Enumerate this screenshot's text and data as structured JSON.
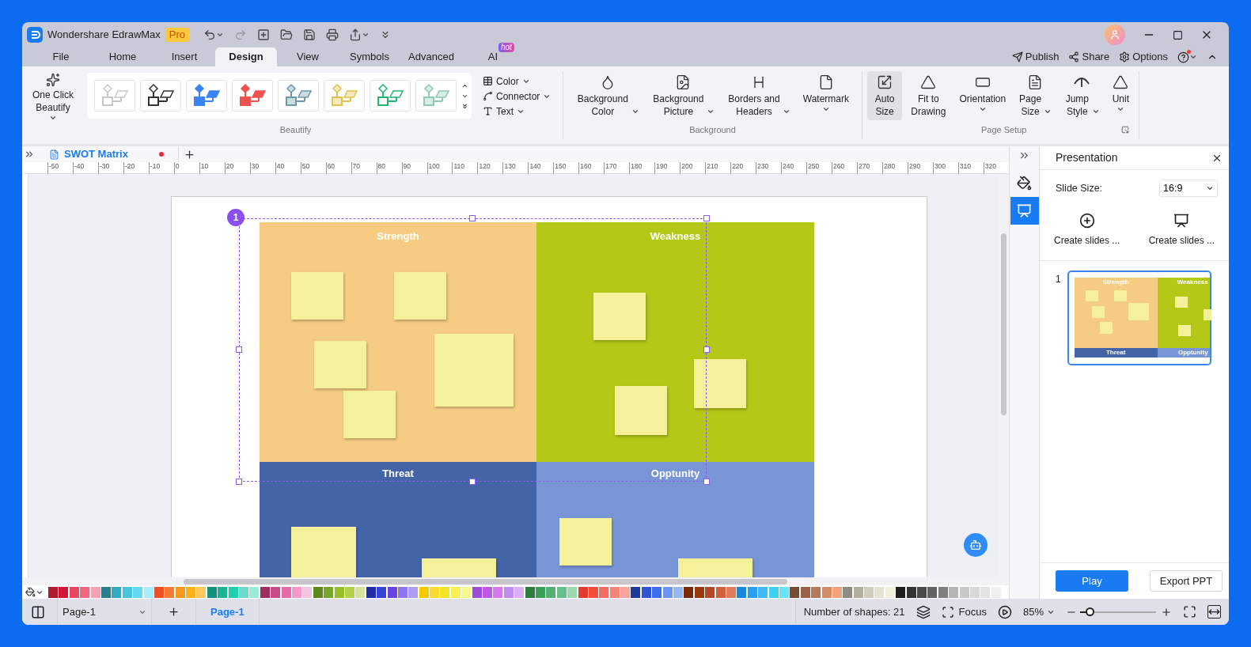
{
  "app": {
    "name": "Wondershare EdrawMax",
    "badge": "Pro"
  },
  "menu_tabs": [
    {
      "label": "File",
      "selected": false
    },
    {
      "label": "Home",
      "selected": false
    },
    {
      "label": "Insert",
      "selected": false
    },
    {
      "label": "Design",
      "selected": true
    },
    {
      "label": "View",
      "selected": false
    },
    {
      "label": "Symbols",
      "selected": false
    },
    {
      "label": "Advanced",
      "selected": false
    },
    {
      "label": "AI",
      "selected": false,
      "badge": "hot"
    }
  ],
  "header_actions": [
    {
      "label": "Publish"
    },
    {
      "label": "Share"
    },
    {
      "label": "Options"
    }
  ],
  "help": {
    "notification": true
  },
  "ribbon": {
    "one_click": {
      "label": "One Click Beautify"
    },
    "styles": [
      {
        "kind": "outline",
        "color": "#c8c8c8"
      },
      {
        "kind": "outline",
        "color": "#333333"
      },
      {
        "kind": "fill",
        "color": "#3b82f6"
      },
      {
        "kind": "fill",
        "color": "#ef5350"
      },
      {
        "kind": "tint",
        "color": "#6a9aa5"
      },
      {
        "kind": "tint",
        "color": "#e2c04a"
      },
      {
        "kind": "outline",
        "color": "#22b573"
      },
      {
        "kind": "tint",
        "color": "#8fcab0"
      }
    ],
    "format_menus": [
      {
        "label": "Color"
      },
      {
        "label": "Connector"
      },
      {
        "label": "Text"
      }
    ],
    "beautify_label": "Beautify",
    "background": {
      "label": "Background",
      "buttons": [
        {
          "label": "Background Color",
          "kind": "split"
        },
        {
          "label": "Background Picture",
          "kind": "split"
        },
        {
          "label": "Borders and Headers",
          "kind": "split"
        },
        {
          "label": "Watermark",
          "kind": "dropdown"
        }
      ]
    },
    "page_setup": {
      "label": "Page Setup",
      "buttons": [
        {
          "label": "Auto Size",
          "active": true,
          "kind": "plain"
        },
        {
          "label": "Fit to Drawing",
          "active": false,
          "kind": "plain"
        },
        {
          "label": "Orientation",
          "active": false,
          "kind": "dropdown"
        },
        {
          "label": "Page Size",
          "active": false,
          "kind": "split"
        },
        {
          "label": "Jump Style",
          "active": false,
          "kind": "split"
        },
        {
          "label": "Unit",
          "active": false,
          "kind": "dropdown"
        }
      ]
    }
  },
  "document_tab": {
    "title": "SWOT Matrix",
    "modified": true
  },
  "ruler": [
    "-50",
    "-40",
    "-30",
    "-20",
    "-10",
    "0",
    "10",
    "20",
    "30",
    "40",
    "50",
    "60",
    "70",
    "80",
    "90",
    "100",
    "110",
    "120",
    "130",
    "140",
    "150",
    "160",
    "170",
    "180",
    "190",
    "200",
    "210",
    "220",
    "230",
    "240",
    "250",
    "260",
    "270",
    "280",
    "290",
    "300",
    "310",
    "320"
  ],
  "swot": {
    "quadrants": [
      {
        "label": "Strength",
        "color": "#f5cc82"
      },
      {
        "label": "Weakness",
        "color": "#b5c817"
      },
      {
        "label": "Threat",
        "color": "#4464a8"
      },
      {
        "label": "Opptunity",
        "color": "#7895d6"
      }
    ],
    "selection_badge": "1"
  },
  "palette": [
    {
      "color": "#b01c2e"
    },
    {
      "color": "#d0163a"
    },
    {
      "color": "#e8475f"
    },
    {
      "color": "#f0677f"
    },
    {
      "color": "#f5a3b3"
    },
    {
      "color": "#2a7f8f"
    },
    {
      "color": "#38a8c0"
    },
    {
      "color": "#47c3dd"
    },
    {
      "color": "#63d8ef"
    },
    {
      "color": "#a8ecfa"
    },
    {
      "color": "#f04e23"
    },
    {
      "color": "#f57c35"
    },
    {
      "color": "#f8971d"
    },
    {
      "color": "#fbb21a"
    },
    {
      "color": "#fcc860"
    },
    {
      "color": "#12927a"
    },
    {
      "color": "#1cb394"
    },
    {
      "color": "#21cfb0"
    },
    {
      "color": "#6bdccb"
    },
    {
      "color": "#9aebd9"
    },
    {
      "color": "#9c2e62"
    },
    {
      "color": "#c94c8a"
    },
    {
      "color": "#e46aa8"
    },
    {
      "color": "#f497c9"
    },
    {
      "color": "#f4c6dd"
    },
    {
      "color": "#5a8a1a"
    },
    {
      "color": "#78a62a"
    },
    {
      "color": "#98be2c"
    },
    {
      "color": "#b4d04c"
    },
    {
      "color": "#d4e39a"
    },
    {
      "color": "#1f2ea8"
    },
    {
      "color": "#3642d8"
    },
    {
      "color": "#6a43e6"
    },
    {
      "color": "#8d74f0"
    },
    {
      "color": "#ad9ef3"
    },
    {
      "color": "#fac800"
    },
    {
      "color": "#fcd832"
    },
    {
      "color": "#f2e526"
    },
    {
      "color": "#f7f050"
    },
    {
      "color": "#f9f78f"
    },
    {
      "color": "#9a4ed6"
    },
    {
      "color": "#c257e6"
    },
    {
      "color": "#d678f0"
    },
    {
      "color": "#c08cf0"
    },
    {
      "color": "#dcaef5"
    },
    {
      "color": "#2d7b3f"
    },
    {
      "color": "#3b9e58"
    },
    {
      "color": "#52b073"
    },
    {
      "color": "#66c08a"
    },
    {
      "color": "#9ad8ae"
    },
    {
      "color": "#e33b2f"
    },
    {
      "color": "#f44b3b"
    },
    {
      "color": "#f56b63"
    },
    {
      "color": "#f58578"
    },
    {
      "color": "#f8a39c"
    },
    {
      "color": "#1e3a9a"
    },
    {
      "color": "#2f56d0"
    },
    {
      "color": "#3e6ef0"
    },
    {
      "color": "#6a94f5"
    },
    {
      "color": "#95b6f2"
    },
    {
      "color": "#7a2a05"
    },
    {
      "color": "#9a3a0a"
    },
    {
      "color": "#b5482a"
    },
    {
      "color": "#d0603f"
    },
    {
      "color": "#e07b5e"
    },
    {
      "color": "#1a88d8"
    },
    {
      "color": "#2aa0ec"
    },
    {
      "color": "#3fb8f5"
    },
    {
      "color": "#3dd0f5"
    },
    {
      "color": "#6ae2fa"
    },
    {
      "color": "#7a4c33"
    },
    {
      "color": "#9a6148"
    },
    {
      "color": "#b57a5a"
    },
    {
      "color": "#d48d68"
    },
    {
      "color": "#f3a27a"
    },
    {
      "color": "#8f8a84"
    },
    {
      "color": "#b2afa1"
    },
    {
      "color": "#cfcdbb"
    },
    {
      "color": "#e5e2d4"
    },
    {
      "color": "#f3efdf"
    },
    {
      "color": "#1e1e1e"
    },
    {
      "color": "#333333"
    },
    {
      "color": "#4a4a4a"
    },
    {
      "color": "#636363"
    },
    {
      "color": "#808080"
    },
    {
      "color": "#b5b5b5"
    },
    {
      "color": "#c8c8c8"
    },
    {
      "color": "#d8d8d8"
    },
    {
      "color": "#e3e3e3"
    },
    {
      "color": "#efefef"
    }
  ],
  "side_icons": [
    {
      "selected": false
    },
    {
      "selected": true
    }
  ],
  "panel": {
    "title": "Presentation",
    "slide_size_label": "Slide Size:",
    "slide_size": "16:9",
    "create_buttons": [
      {
        "label": "Create slides ..."
      },
      {
        "label": "Create slides ..."
      }
    ],
    "slides": [
      {
        "number": "1",
        "selected": true,
        "labels": [
          "Strength",
          "Weakness",
          "Threat",
          "Opptunity"
        ]
      }
    ],
    "play": "Play",
    "export": "Export PPT"
  },
  "status_bar": {
    "page_select": "Page-1",
    "pages": [
      {
        "label": "Page-1",
        "selected": true
      }
    ],
    "shape_count": "Number of shapes: 21",
    "focus": "Focus",
    "zoom": "85%",
    "zoom_slider": {
      "level": 0.13
    }
  }
}
